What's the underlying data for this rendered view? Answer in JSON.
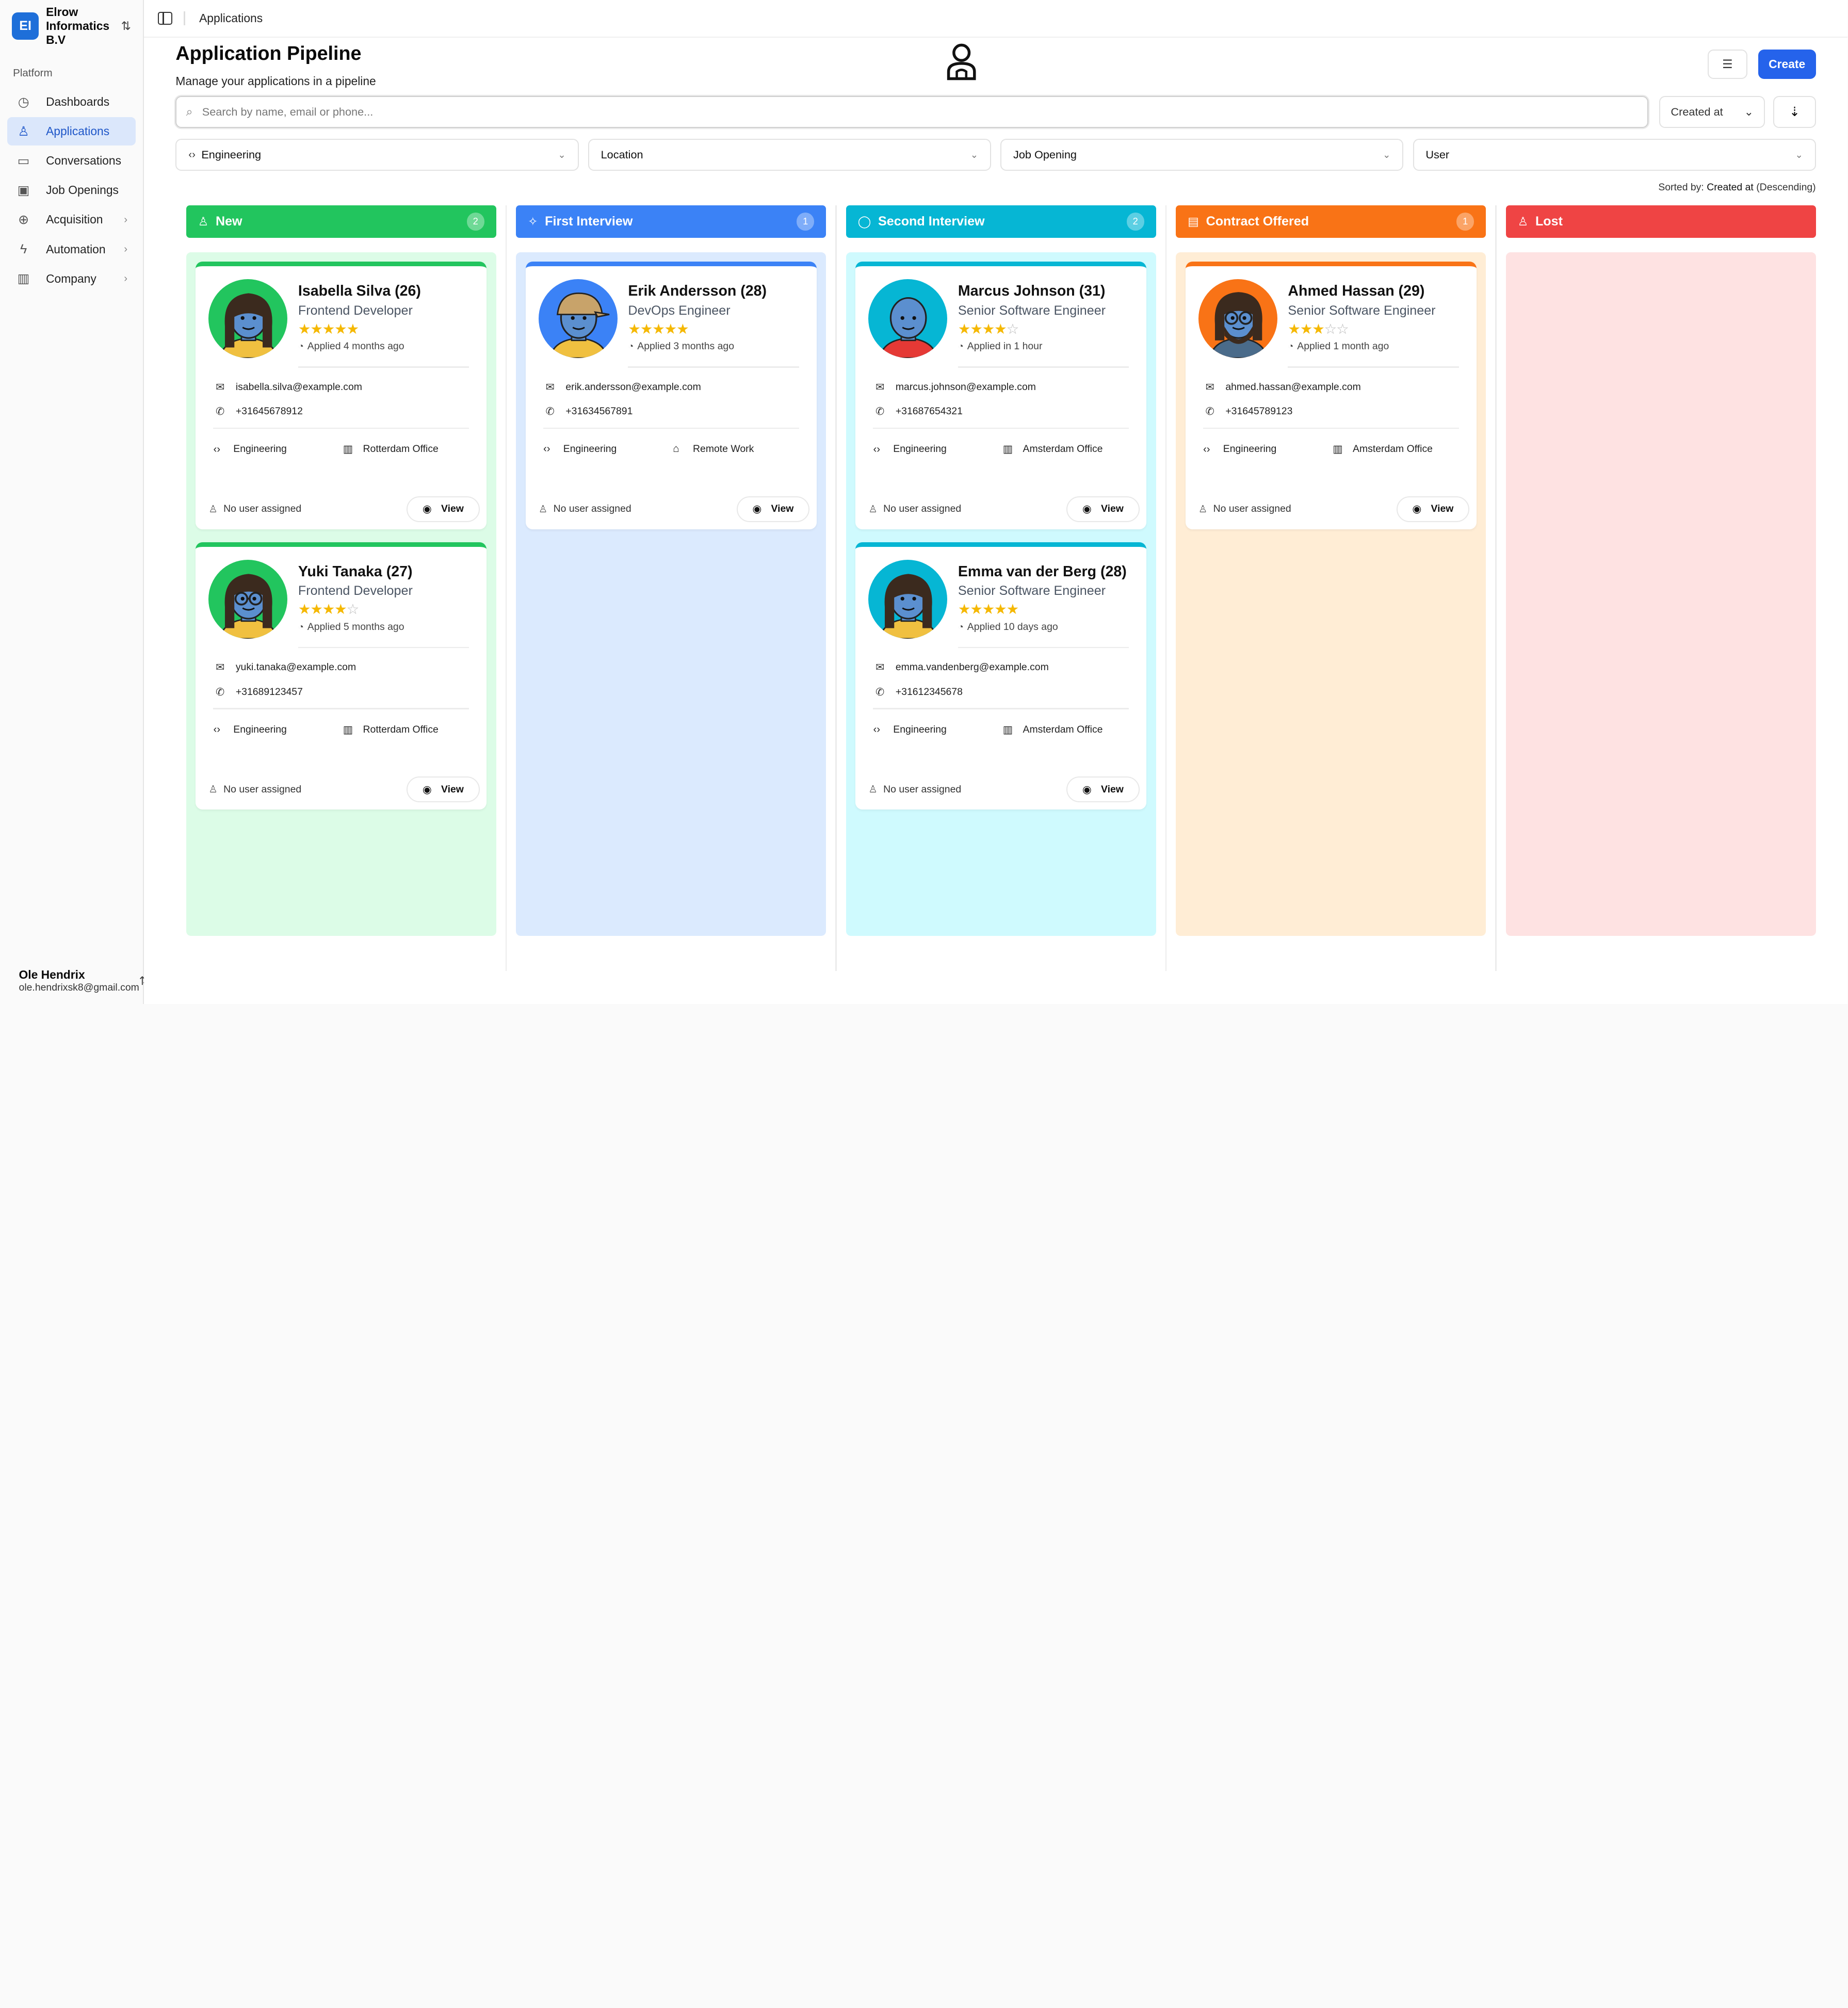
{
  "org": {
    "name": "Elrow Informatics B.V",
    "logo_text": "EI"
  },
  "sidebar": {
    "section_label": "Platform",
    "items": [
      {
        "label": "Dashboards",
        "icon": "gauge-icon",
        "active": false,
        "has_submenu": false
      },
      {
        "label": "Applications",
        "icon": "user-icon",
        "active": true,
        "has_submenu": false
      },
      {
        "label": "Conversations",
        "icon": "chat-icon",
        "active": false,
        "has_submenu": false
      },
      {
        "label": "Job Openings",
        "icon": "briefcase-icon",
        "active": false,
        "has_submenu": false
      },
      {
        "label": "Acquisition",
        "icon": "crosshair-icon",
        "active": false,
        "has_submenu": true
      },
      {
        "label": "Automation",
        "icon": "lightning-icon",
        "active": false,
        "has_submenu": true
      },
      {
        "label": "Company",
        "icon": "building-icon",
        "active": false,
        "has_submenu": true
      }
    ]
  },
  "user": {
    "name": "Ole Hendrix",
    "email": "ole.hendrixsk8@gmail.com"
  },
  "topbar": {
    "breadcrumb": "Applications"
  },
  "page": {
    "title": "Application Pipeline",
    "subtitle": "Manage your applications in a pipeline",
    "create_label": "Create"
  },
  "search": {
    "placeholder": "Search by name, email or phone...",
    "value": ""
  },
  "sort": {
    "field": "Created at"
  },
  "filters": [
    {
      "label": "Engineering",
      "icon": "code-icon"
    },
    {
      "label": "Location",
      "icon": ""
    },
    {
      "label": "Job Opening",
      "icon": ""
    },
    {
      "label": "User",
      "icon": ""
    }
  ],
  "sorted_by": {
    "prefix": "Sorted by:",
    "field": "Created at",
    "direction": "(Descending)"
  },
  "columns": [
    {
      "title": "New",
      "count": "2",
      "color": "#22c55e",
      "bg": "#dcfce7",
      "icon": "user-plus-icon",
      "cards": [
        {
          "name": "Isabella Silva (26)",
          "role": "Frontend Developer",
          "rating": 5,
          "applied": "Applied 4 months ago",
          "email": "isabella.silva@example.com",
          "phone": "+31645678912",
          "department": "Engineering",
          "location": "Rotterdam Office",
          "location_icon": "building-icon",
          "assigned": "No user assigned",
          "view_label": "View",
          "avatar_bg": "#22c55e",
          "avatar_style": "long-hair"
        },
        {
          "name": "Yuki Tanaka (27)",
          "role": "Frontend Developer",
          "rating": 4,
          "applied": "Applied 5 months ago",
          "email": "yuki.tanaka@example.com",
          "phone": "+31689123457",
          "department": "Engineering",
          "location": "Rotterdam Office",
          "location_icon": "building-icon",
          "assigned": "No user assigned",
          "view_label": "View",
          "avatar_bg": "#22c55e",
          "avatar_style": "glasses"
        }
      ]
    },
    {
      "title": "First Interview",
      "count": "1",
      "color": "#3b82f6",
      "bg": "#dbeafe",
      "icon": "audio-icon",
      "cards": [
        {
          "name": "Erik Andersson (28)",
          "role": "DevOps Engineer",
          "rating": 5,
          "applied": "Applied 3 months ago",
          "email": "erik.andersson@example.com",
          "phone": "+31634567891",
          "department": "Engineering",
          "location": "Remote Work",
          "location_icon": "home-icon",
          "assigned": "No user assigned",
          "view_label": "View",
          "avatar_bg": "#3b82f6",
          "avatar_style": "cap"
        }
      ]
    },
    {
      "title": "Second Interview",
      "count": "2",
      "color": "#06b6d4",
      "bg": "#cffafe",
      "icon": "chat-bubble-icon",
      "cards": [
        {
          "name": "Marcus Johnson (31)",
          "role": "Senior Software Engineer",
          "rating": 4,
          "applied": "Applied in 1 hour",
          "email": "marcus.johnson@example.com",
          "phone": "+31687654321",
          "department": "Engineering",
          "location": "Amsterdam Office",
          "location_icon": "building-icon",
          "assigned": "No user assigned",
          "view_label": "View",
          "avatar_bg": "#06b6d4",
          "avatar_style": "bald"
        },
        {
          "name": "Emma van der Berg (28)",
          "role": "Senior Software Engineer",
          "rating": 5,
          "applied": "Applied 10 days ago",
          "email": "emma.vandenberg@example.com",
          "phone": "+31612345678",
          "department": "Engineering",
          "location": "Amsterdam Office",
          "location_icon": "building-icon",
          "assigned": "No user assigned",
          "view_label": "View",
          "avatar_bg": "#06b6d4",
          "avatar_style": "long-hair"
        }
      ]
    },
    {
      "title": "Contract Offered",
      "count": "1",
      "color": "#f97316",
      "bg": "#ffedd5",
      "icon": "document-icon",
      "cards": [
        {
          "name": "Ahmed Hassan (29)",
          "role": "Senior Software Engineer",
          "rating": 3,
          "applied": "Applied 1 month ago",
          "email": "ahmed.hassan@example.com",
          "phone": "+31645789123",
          "department": "Engineering",
          "location": "Amsterdam Office",
          "location_icon": "building-icon",
          "assigned": "No user assigned",
          "view_label": "View",
          "avatar_bg": "#f97316",
          "avatar_style": "beard"
        }
      ]
    },
    {
      "title": "Lost",
      "count": "",
      "color": "#ef4444",
      "bg": "#fee2e2",
      "icon": "user-x-icon",
      "cards": []
    }
  ]
}
